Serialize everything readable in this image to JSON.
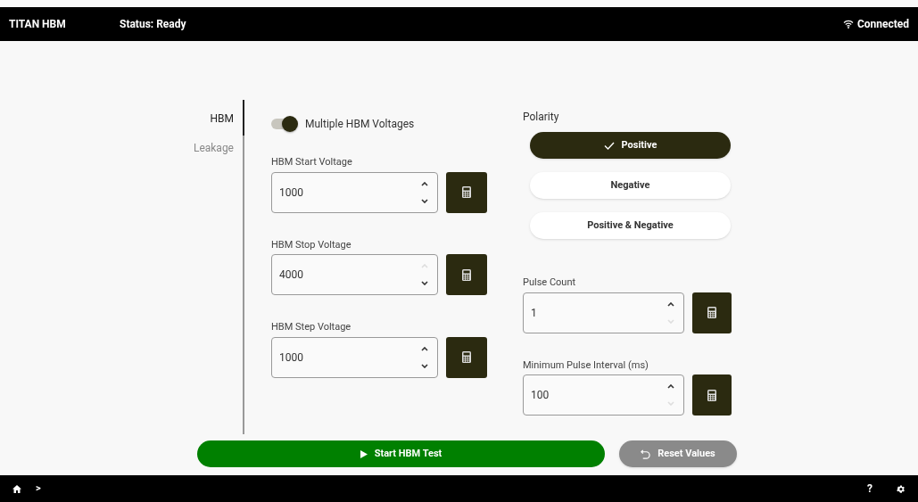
{
  "header": {
    "title": "TITAN HBM",
    "status": "Status: Ready",
    "connection": "Connected"
  },
  "tabs": [
    {
      "label": "HBM",
      "selected": true
    },
    {
      "label": "Leakage",
      "selected": false
    }
  ],
  "toggle": {
    "label": "Multiple HBM Voltages",
    "on": true
  },
  "left_fields": [
    {
      "label": "HBM Start Voltage",
      "value": "1000",
      "up_enabled": true,
      "down_enabled": true
    },
    {
      "label": "HBM Stop Voltage",
      "value": "4000",
      "up_enabled": false,
      "down_enabled": true
    },
    {
      "label": "HBM Step Voltage",
      "value": "1000",
      "up_enabled": true,
      "down_enabled": true
    }
  ],
  "polarity": {
    "label": "Polarity",
    "options": [
      {
        "label": "Positive",
        "selected": true
      },
      {
        "label": "Negative",
        "selected": false
      },
      {
        "label": "Positive & Negative",
        "selected": false
      }
    ]
  },
  "right_fields": [
    {
      "label": "Pulse Count",
      "value": "1",
      "up_enabled": true,
      "down_enabled": false
    },
    {
      "label": "Minimum Pulse Interval (ms)",
      "value": "100",
      "up_enabled": true,
      "down_enabled": false
    }
  ],
  "start_button": {
    "label": "Start HBM Test"
  },
  "reset_button": {
    "label": "Reset Values",
    "disabled": true
  },
  "footer": {
    "breadcrumb": ">",
    "help": "?"
  }
}
